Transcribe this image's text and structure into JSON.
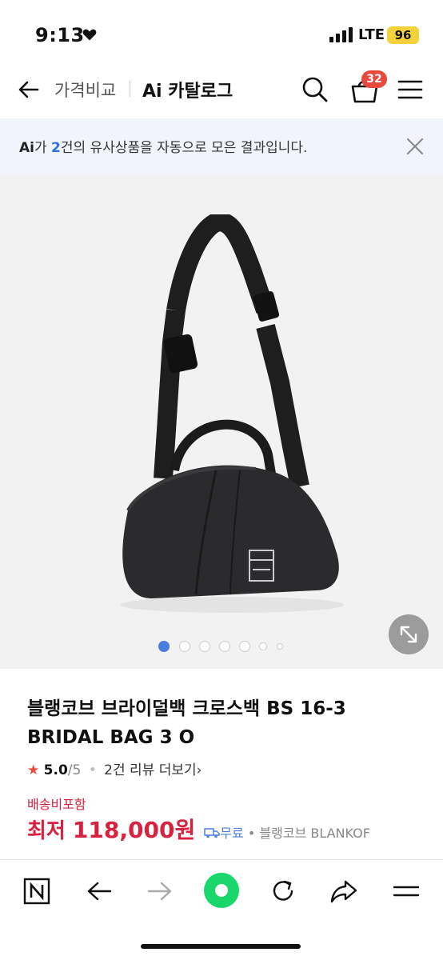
{
  "status_bar": {
    "time": "9:13",
    "network": "LTE",
    "battery": "96"
  },
  "nav": {
    "compare_label": "가격비교",
    "catalog_label": "Ai 카탈로그",
    "cart_count": "32"
  },
  "banner": {
    "ai_label": "Ai",
    "text_before": "가 ",
    "count": "2",
    "text_after": "건의 유사상품을 자동으로 모은 결과입니다."
  },
  "gallery": {
    "total_images": 7,
    "current_index": 0,
    "active_color": "#4a7de0"
  },
  "product": {
    "title": "블랭코브 브라이덜백 크로스백 BS 16-3 BRIDAL BAG 3 O",
    "rating_star": "★",
    "rating_score": "5.0",
    "rating_outof": "/5",
    "review_count_text": "2건 리뷰 더보기",
    "shipping_note": "배송비포함",
    "price_label": "최저 ",
    "price_value": "118,000원",
    "free_shipping": "무료",
    "seller": "블랭코브 BLANKOF"
  },
  "colors": {
    "accent_red": "#d8203f",
    "badge_red": "#e8493d",
    "link_blue": "#2b6fe0",
    "banner_bg": "#f1f4fa"
  },
  "toolbar_icons": [
    "naver-n-icon",
    "back-arrow-icon",
    "forward-arrow-icon",
    "green-home-icon",
    "refresh-icon",
    "share-icon",
    "menu-icon"
  ]
}
